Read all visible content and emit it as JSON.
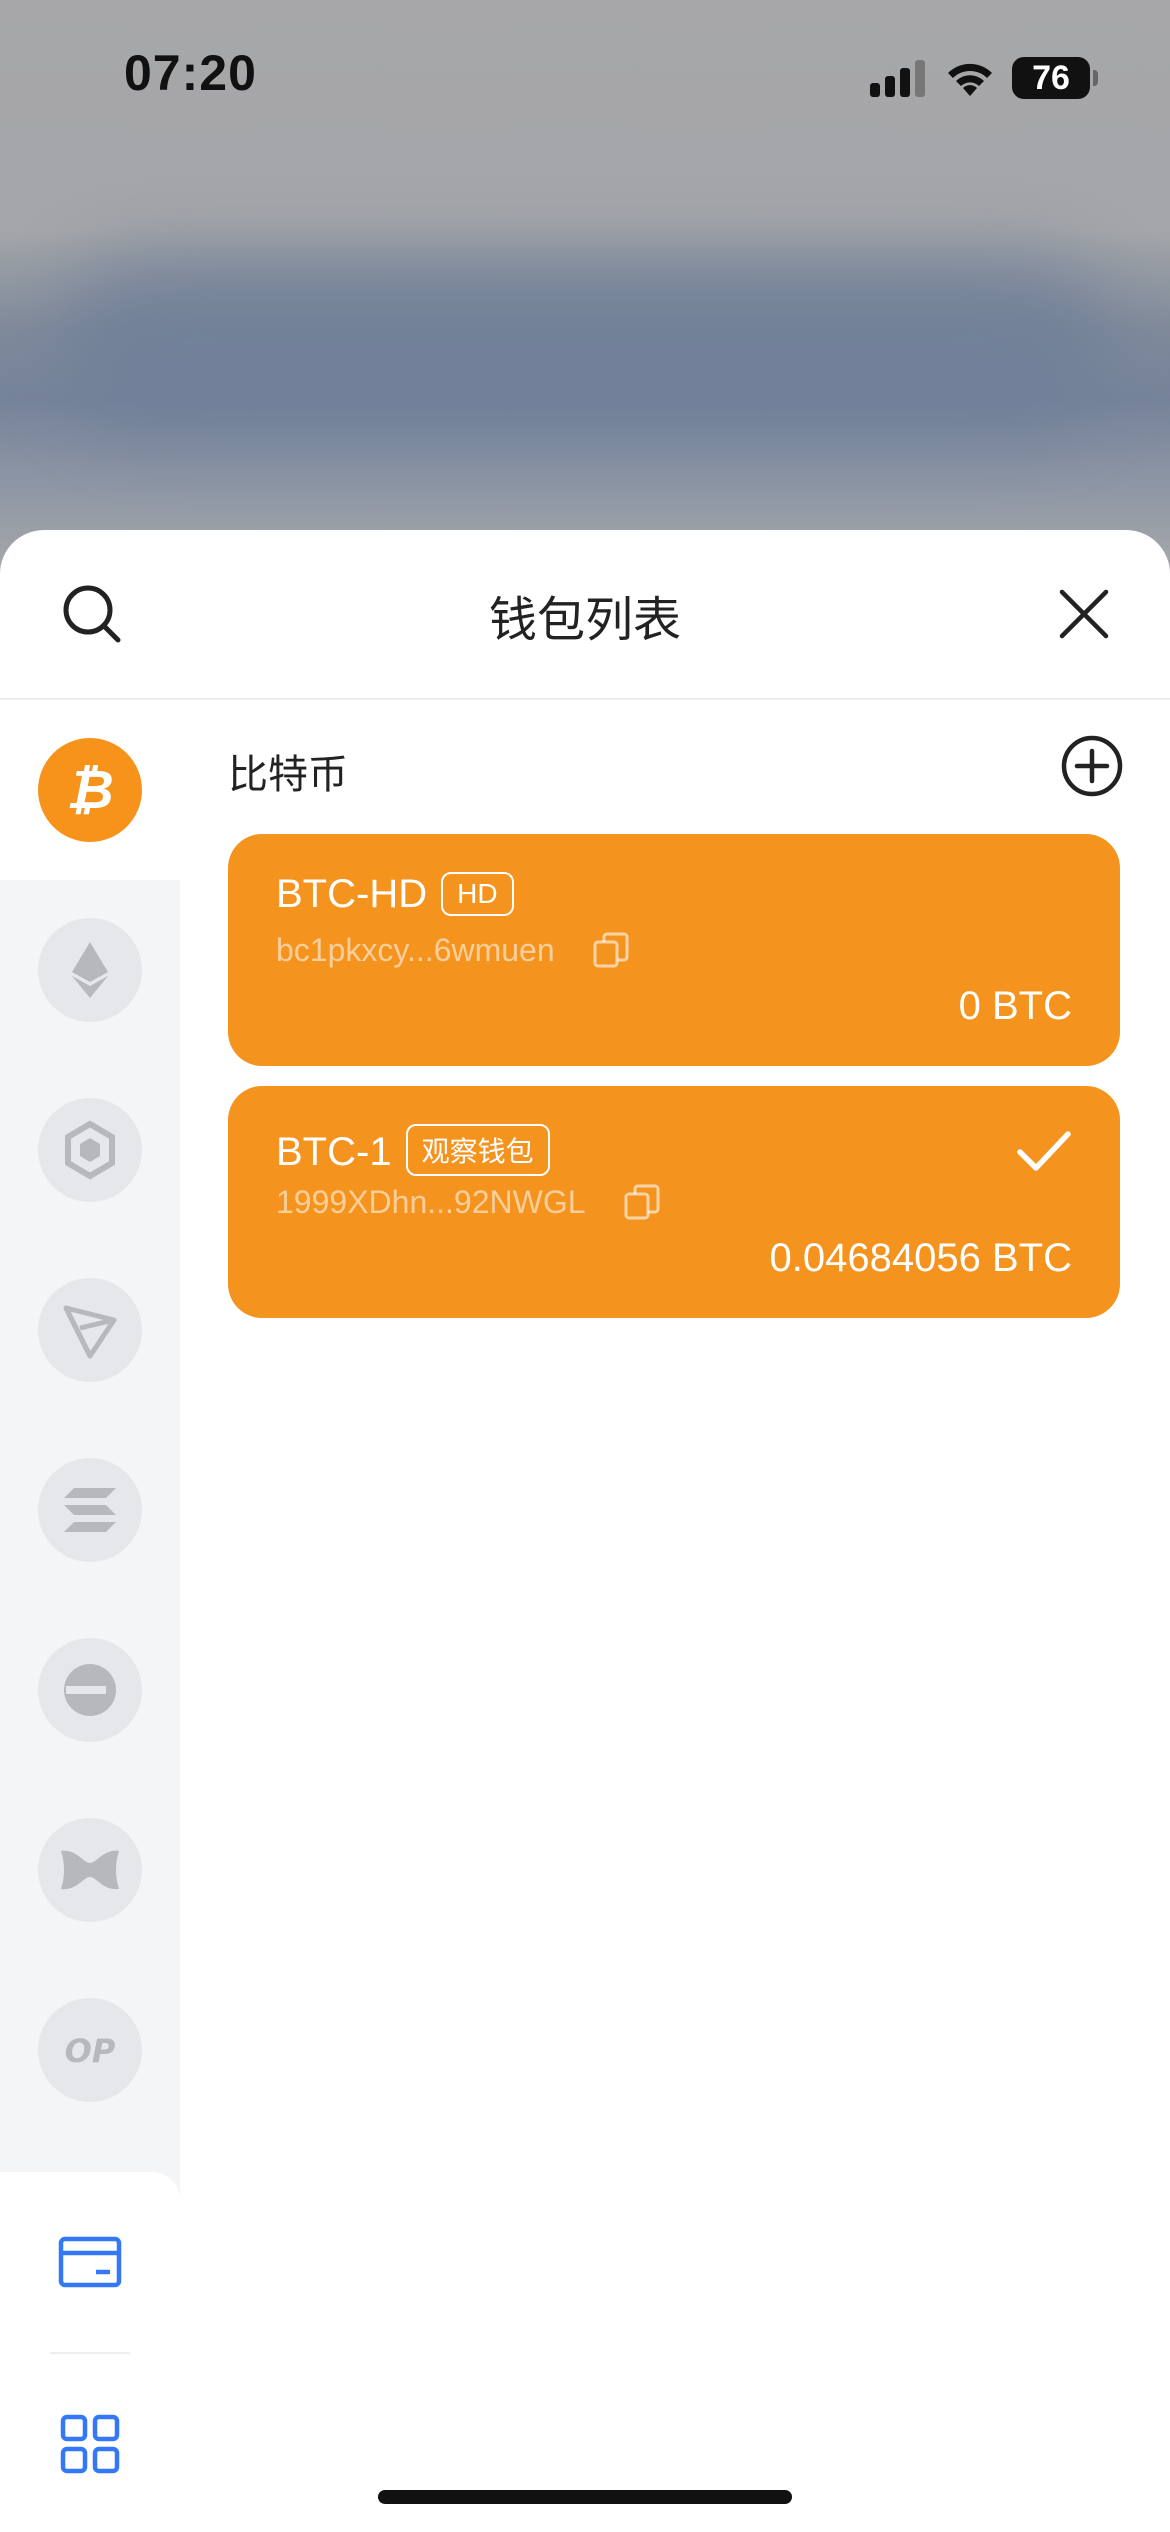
{
  "status_bar": {
    "time": "07:20",
    "battery": "76"
  },
  "header": {
    "title": "钱包列表"
  },
  "sidebar": {
    "chains": [
      {
        "name": "bitcoin",
        "active": true
      },
      {
        "name": "ethereum"
      },
      {
        "name": "bnb"
      },
      {
        "name": "tron"
      },
      {
        "name": "solana"
      },
      {
        "name": "chain-6"
      },
      {
        "name": "chain-7"
      },
      {
        "name": "optimism",
        "label": "OP"
      }
    ],
    "bottom": [
      {
        "name": "wallet-card-icon"
      },
      {
        "name": "grid-apps-icon"
      }
    ]
  },
  "section": {
    "title": "比特币"
  },
  "wallets": [
    {
      "name": "BTC-HD",
      "tag": "HD",
      "address": "bc1pkxcy...6wmuen",
      "balance": "0 BTC",
      "selected": false
    },
    {
      "name": "BTC-1",
      "tag": "观察钱包",
      "address": "1999XDhn...92NWGL",
      "balance": "0.04684056 BTC",
      "selected": true
    }
  ],
  "colors": {
    "accent": "#F5931F",
    "sidebar_bg": "#F4F5F7",
    "coin_bg": "#E6E7EB",
    "blue_icon": "#3478F6"
  }
}
